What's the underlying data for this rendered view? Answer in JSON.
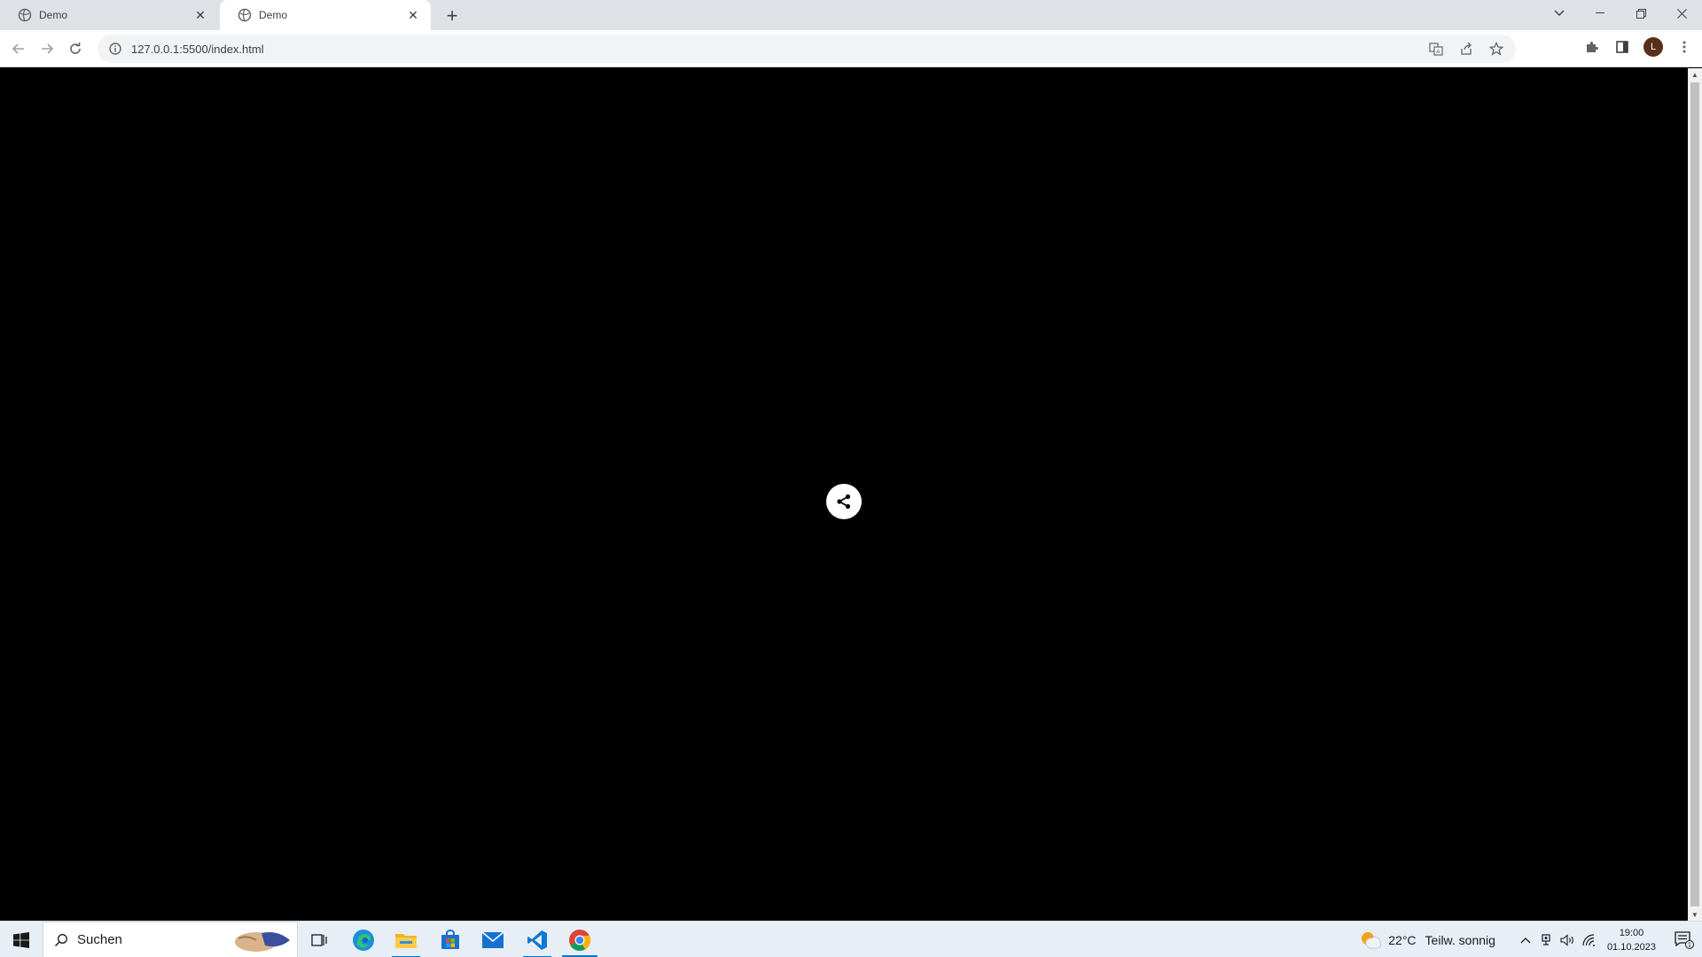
{
  "browser": {
    "tabs": [
      {
        "title": "Demo",
        "active": false
      },
      {
        "title": "Demo",
        "active": true
      }
    ],
    "new_tab_label": "+",
    "url": "127.0.0.1:5500/index.html",
    "profile_initial": "L"
  },
  "page": {
    "background": "#000000",
    "share_button_icon": "share-icon"
  },
  "taskbar": {
    "search_placeholder": "Suchen",
    "weather_temp": "22°C",
    "weather_text": "Teilw. sonnig",
    "time": "19:00",
    "date": "01.10.2023",
    "notification_count": "1",
    "apps": [
      "task-view",
      "edge",
      "file-explorer",
      "microsoft-store",
      "mail",
      "vscode",
      "chrome"
    ]
  },
  "colors": {
    "accent": "#0078d4",
    "tabstrip": "#dee1e6",
    "avatar": "#5b2e1c"
  }
}
